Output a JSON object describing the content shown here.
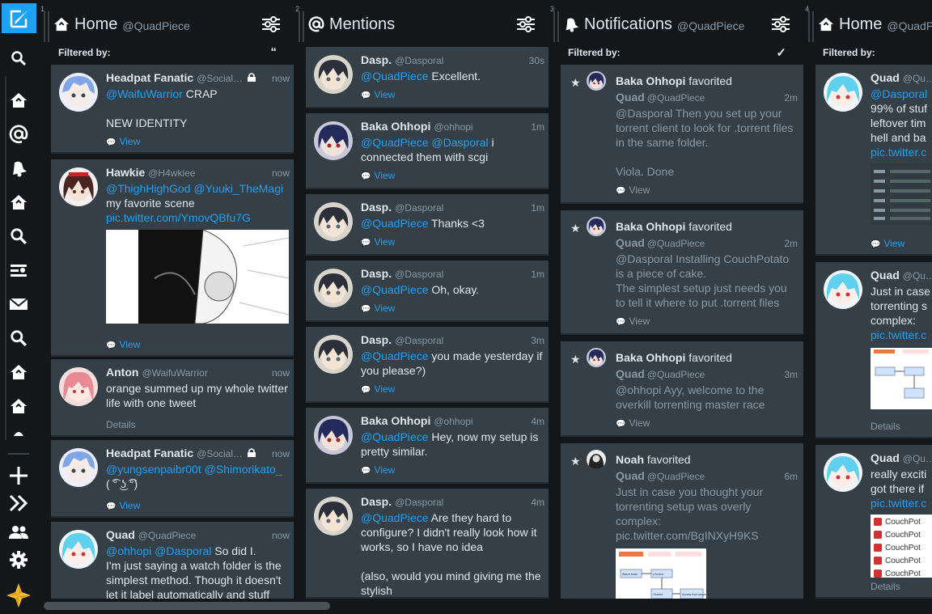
{
  "nav": {
    "items": [
      "compose-icon",
      "search-icon",
      "home-icon",
      "mentions-icon",
      "notifications-icon",
      "home-icon",
      "search-icon",
      "lists-icon",
      "messages-icon",
      "search-icon",
      "home-icon",
      "home-icon",
      "collapse-icon",
      "add-column-icon",
      "expand-icon",
      "accounts-icon",
      "settings-icon",
      "tweetdeck-logo-icon"
    ]
  },
  "columns": [
    {
      "num": "1",
      "title": "Home",
      "sub": "@QuadPiece",
      "icon": "home-icon",
      "filter_label": "Filtered by:",
      "filter_icon": "“",
      "tweets": [
        {
          "name": "Headpat Fanatic",
          "handle": "@Social…",
          "locked": true,
          "time": "now",
          "text_parts": [
            {
              "m": true,
              "t": "@WaifuWarrior"
            },
            {
              "m": false,
              "t": " CRAP\n\nNEW IDENTITY"
            }
          ],
          "link": "View",
          "link_kind": "view"
        },
        {
          "name": "Hawkie",
          "handle": "@H4wkiee",
          "locked": false,
          "time": "now",
          "text_parts": [
            {
              "m": true,
              "t": "@ThighHighGod @Yuuki_TheMagi"
            },
            {
              "m": false,
              "t": "\nmy favorite scene\n"
            },
            {
              "m": true,
              "t": "pic.twitter.com/YmovQBfu7G"
            }
          ],
          "link": "View",
          "link_kind": "view"
        },
        {
          "name": "Anton",
          "handle": "@WaifuWarrior",
          "locked": false,
          "time": "now",
          "text_parts": [
            {
              "m": false,
              "t": "orange summed up my whole twitter life with one tweet"
            }
          ],
          "link": "Details",
          "link_kind": "details"
        },
        {
          "name": "Headpat Fanatic",
          "handle": "@Social…",
          "locked": true,
          "time": "now",
          "text_parts": [
            {
              "m": true,
              "t": "@yungsenpaibr00t @Shimorikato_"
            },
            {
              "m": false,
              "t": "\n( ͡° ͜ʖ ͡°)"
            }
          ],
          "link": "View",
          "link_kind": "view"
        },
        {
          "name": "Quad",
          "handle": "@QuadPiece",
          "locked": false,
          "time": "now",
          "text_parts": [
            {
              "m": true,
              "t": "@ohhopi @Dasporal"
            },
            {
              "m": false,
              "t": " So did I.\nI'm just saying a watch folder is the simplest method. Though it doesn't let it label automatically and stuff"
            }
          ],
          "link": "",
          "link_kind": "none"
        }
      ]
    },
    {
      "num": "2",
      "title": "Mentions",
      "sub": "",
      "icon": "mentions-icon",
      "tweets": [
        {
          "name": "Dasp.",
          "handle": "@Dasporal",
          "time": "30s",
          "text_parts": [
            {
              "m": true,
              "t": "@QuadPiece"
            },
            {
              "m": false,
              "t": " Excellent."
            }
          ],
          "link": "View"
        },
        {
          "name": "Baka Ohhopi",
          "handle": "@ohhopi",
          "time": "1m",
          "text_parts": [
            {
              "m": true,
              "t": "@QuadPiece @Dasporal"
            },
            {
              "m": false,
              "t": " i connected them with scgi"
            }
          ],
          "link": "View"
        },
        {
          "name": "Dasp.",
          "handle": "@Dasporal",
          "time": "1m",
          "text_parts": [
            {
              "m": true,
              "t": "@QuadPiece"
            },
            {
              "m": false,
              "t": " Thanks <3"
            }
          ],
          "link": "View"
        },
        {
          "name": "Dasp.",
          "handle": "@Dasporal",
          "time": "1m",
          "text_parts": [
            {
              "m": true,
              "t": "@QuadPiece"
            },
            {
              "m": false,
              "t": " Oh, okay."
            }
          ],
          "link": "View"
        },
        {
          "name": "Dasp.",
          "handle": "@Dasporal",
          "time": "3m",
          "text_parts": [
            {
              "m": true,
              "t": "@QuadPiece"
            },
            {
              "m": false,
              "t": " you made yesterday if you please?)"
            }
          ],
          "link": "View"
        },
        {
          "name": "Baka Ohhopi",
          "handle": "@ohhopi",
          "time": "4m",
          "text_parts": [
            {
              "m": true,
              "t": "@QuadPiece"
            },
            {
              "m": false,
              "t": " Hey, now my setup is pretty similar."
            }
          ],
          "link": "View"
        },
        {
          "name": "Dasp.",
          "handle": "@Dasporal",
          "time": "4m",
          "text_parts": [
            {
              "m": true,
              "t": "@QuadPiece"
            },
            {
              "m": false,
              "t": " Are they hard to configure? I didn't really look how it works, so I have no idea\n\n(also, would you mind giving me the stylish"
            }
          ],
          "link": ""
        }
      ]
    },
    {
      "num": "3",
      "title": "Notifications",
      "sub": "@QuadPiece",
      "icon": "notifications-icon",
      "filter_label": "Filtered by:",
      "filter_icon": "✓",
      "notifs": [
        {
          "actor": "Baka Ohhopi",
          "action": " favorited",
          "who": "Quad",
          "handle": "@QuadPiece",
          "time": "2m",
          "text": "@Dasporal Then you set up your torrent client to look for .torrent files in the same folder.\n\nViola. Done",
          "link": "View"
        },
        {
          "actor": "Baka Ohhopi",
          "action": " favorited",
          "who": "Quad",
          "handle": "@QuadPiece",
          "time": "2m",
          "text": "@Dasporal Installing CouchPotato is a piece of cake.\nThe simplest setup just needs you to tell it where to put .torrent files",
          "link": "View"
        },
        {
          "actor": "Baka Ohhopi",
          "action": " favorited",
          "who": "Quad",
          "handle": "@QuadPiece",
          "time": "3m",
          "text": "@ohhopi Ayy, welcome to the overkill torrenting master race",
          "link": "View"
        },
        {
          "actor": "Noah",
          "action": " favorited",
          "who": "Quad",
          "handle": "@QuadPiece",
          "time": "6m",
          "text": "Just in case you thought your torrenting setup was overly complex:\npic.twitter.com/BgINXyH9KS",
          "link": ""
        }
      ]
    },
    {
      "num": "4",
      "title": "Home",
      "sub": "@QuadPiece",
      "icon": "home-icon",
      "filter_label": "Filtered by:",
      "tweets": [
        {
          "name": "Quad",
          "handle": "@Qu…",
          "text_parts": [
            {
              "m": true,
              "t": "@Dasporal"
            },
            {
              "m": false,
              "t": "\n99% of stuf\nleftover tim\nhell and ba\n"
            },
            {
              "m": true,
              "t": "pic.twitter.c"
            }
          ],
          "link": "View"
        },
        {
          "name": "Quad",
          "handle": "@Qu…",
          "text_parts": [
            {
              "m": false,
              "t": "Just in case\ntorrenting s\ncomplex:\n"
            },
            {
              "m": true,
              "t": "pic.twitter.c"
            }
          ],
          "link": "Details"
        },
        {
          "name": "Quad",
          "handle": "@Qu…",
          "text_parts": [
            {
              "m": false,
              "t": "really exciti\ngot there if\n"
            },
            {
              "m": true,
              "t": "pic.twitter.c"
            }
          ],
          "link": "Details"
        }
      ]
    }
  ],
  "col4_thumb_labels": [
    "CouchPot",
    "CouchPot",
    "CouchPot",
    "CouchPot",
    "CouchPot"
  ],
  "diagram_labels": [
    "Watch folder",
    "uTorrent",
    "rTorrent",
    "Access from anywhere"
  ]
}
